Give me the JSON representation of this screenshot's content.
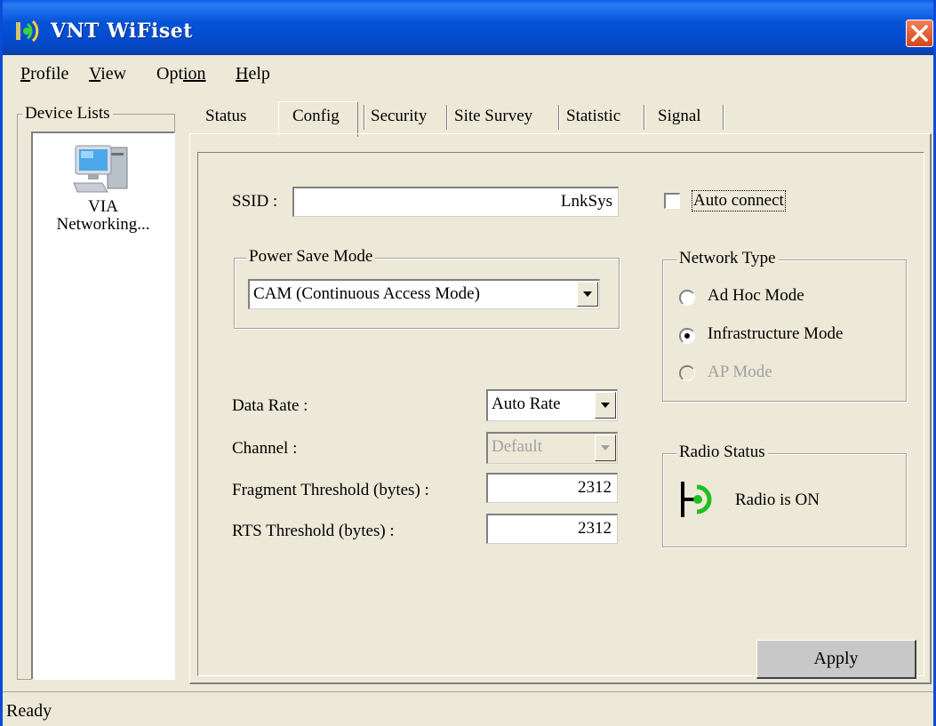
{
  "window": {
    "title": "VNT WiFiset",
    "accent_color": "#0a5fe8",
    "close_color": "#d8451a",
    "title_icon": "wifi-signal-icon"
  },
  "menu": {
    "items": [
      {
        "first": "P",
        "rest": "rofile"
      },
      {
        "first": "V",
        "rest": "iew"
      },
      {
        "first": "Opt",
        "rest": "ion",
        "underline_index": 3
      },
      {
        "first": "H",
        "rest": "elp"
      }
    ]
  },
  "device_lists": {
    "legend": "Device Lists",
    "device_icon": "computer-icon",
    "device_name_line1": "VIA",
    "device_name_line2": "Networking..."
  },
  "tabs": {
    "items": [
      "Status",
      "Config",
      "Security",
      "Site Survey",
      "Statistic",
      "Signal"
    ],
    "selected": "Config"
  },
  "config": {
    "ssid_label": "SSID :",
    "ssid_value": "LnkSys",
    "auto_connect_label": "Auto connect",
    "auto_connect_checked": false,
    "power_save": {
      "legend": "Power Save Mode",
      "value": "CAM (Continuous Access Mode)"
    },
    "network_type": {
      "legend": "Network Type",
      "options": [
        {
          "label": "Ad Hoc Mode",
          "checked": false,
          "disabled": false
        },
        {
          "label": "Infrastructure Mode",
          "checked": true,
          "disabled": false
        },
        {
          "label": "AP Mode",
          "checked": false,
          "disabled": true
        }
      ]
    },
    "data_rate_label": "Data Rate :",
    "data_rate_value": "Auto Rate",
    "channel_label": "Channel :",
    "channel_value": "Default",
    "fragment_label": "Fragment Threshold (bytes) :",
    "fragment_value": "2312",
    "rts_label": "RTS Threshold (bytes) :",
    "rts_value": "2312",
    "radio_status": {
      "legend": "Radio Status",
      "icon": "radio-on-icon",
      "text": "Radio is ON",
      "color": "#1fbf1f"
    },
    "apply_label": "Apply"
  },
  "status_bar": {
    "text": "Ready"
  }
}
